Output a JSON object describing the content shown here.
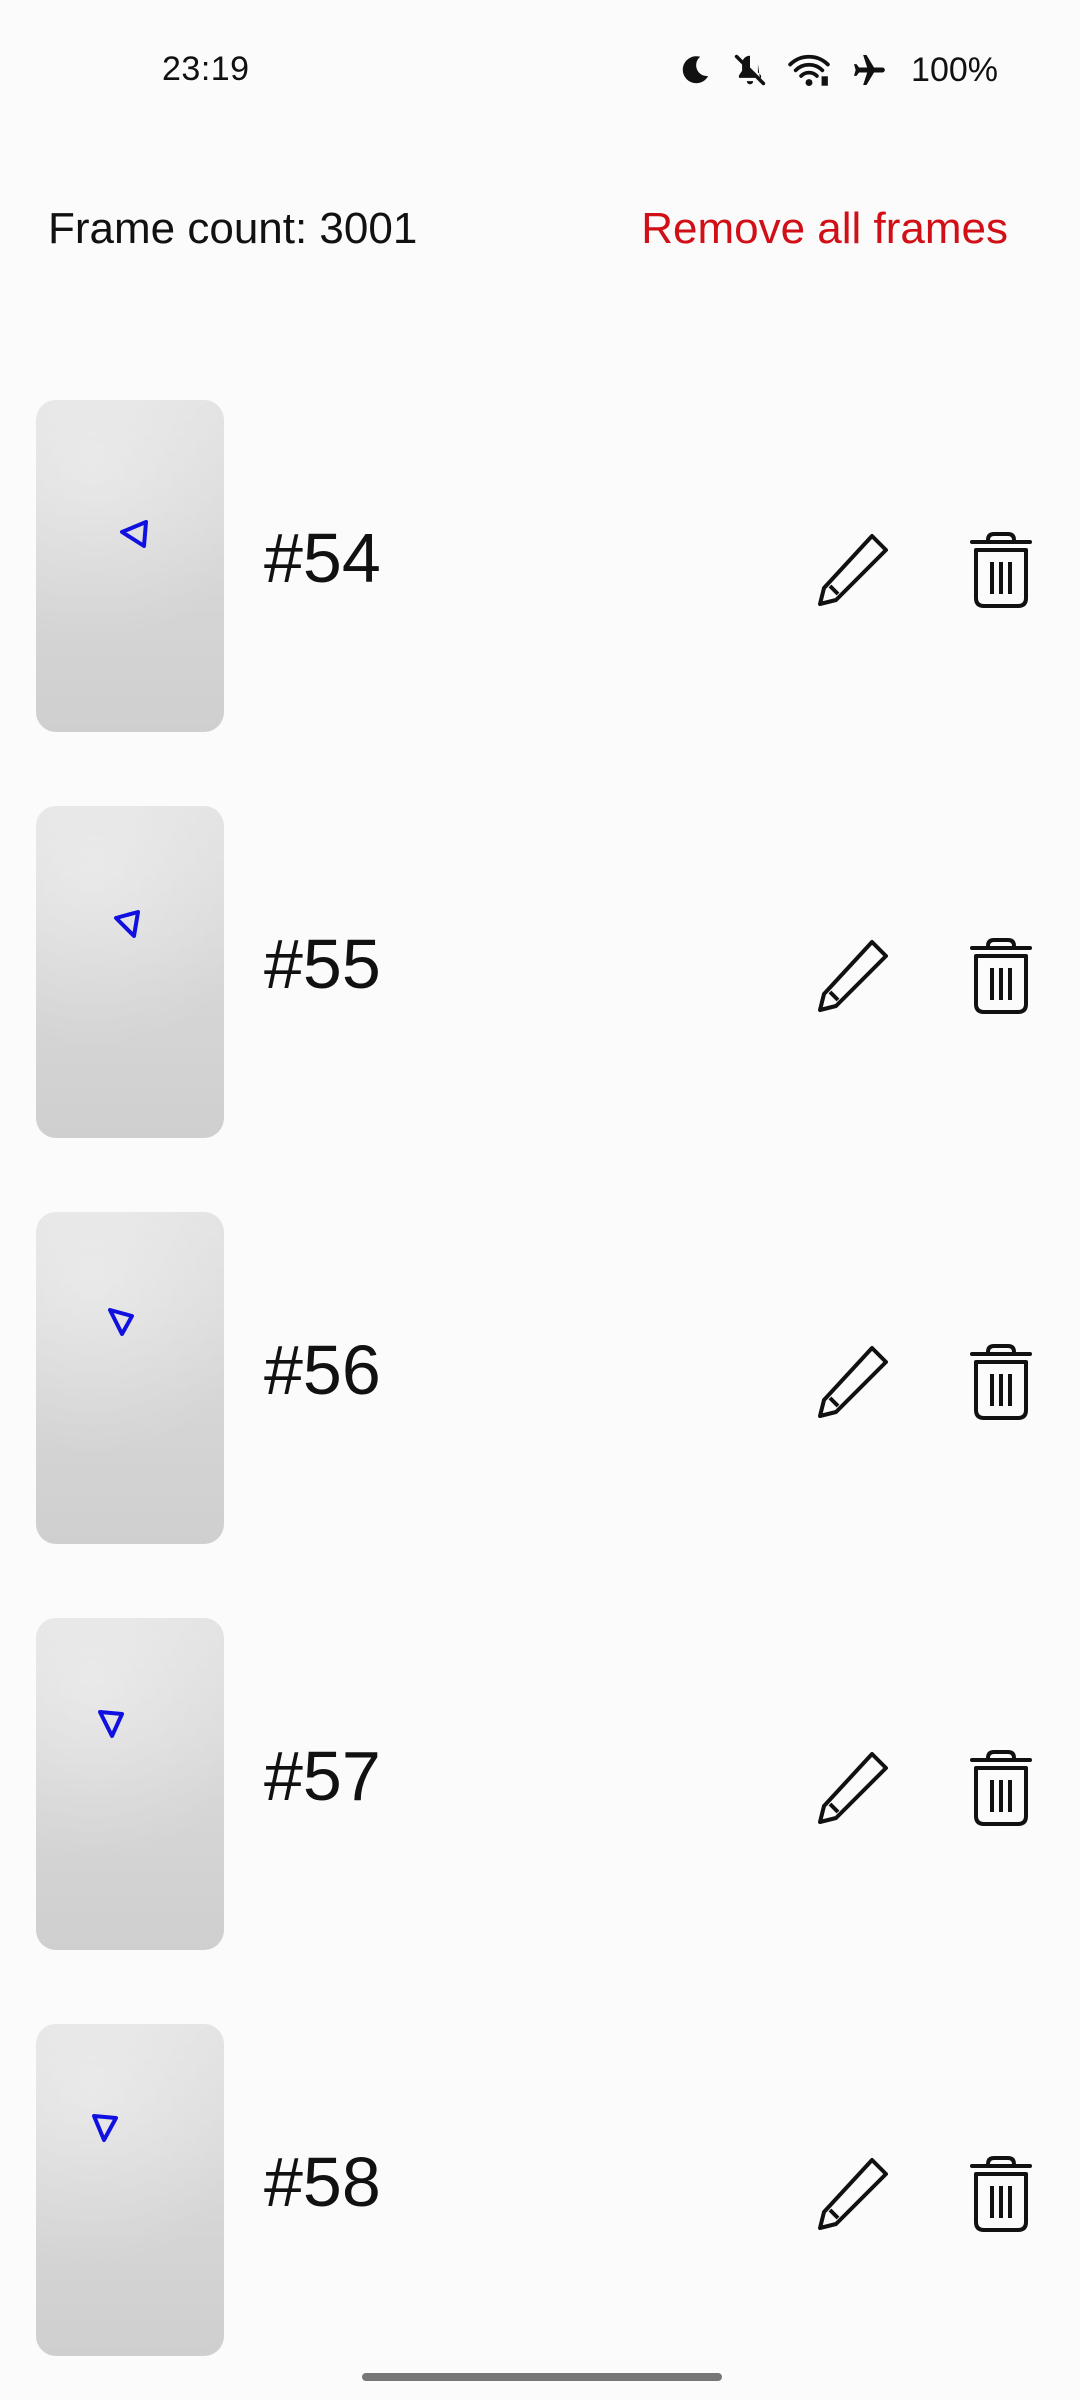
{
  "status_bar": {
    "time": "23:19",
    "icons": [
      "moon-icon",
      "bell-off-icon",
      "wifi-icon",
      "airplane-icon"
    ],
    "battery": "100%"
  },
  "header": {
    "frame_count": "Frame count: 3001",
    "remove_all_label": "Remove all frames",
    "remove_all_color": "#d10f16"
  },
  "frames": [
    {
      "label": "#54"
    },
    {
      "label": "#55"
    },
    {
      "label": "#56"
    },
    {
      "label": "#57"
    },
    {
      "label": "#58"
    }
  ],
  "frame_actions": {
    "edit_icon": "pencil-icon",
    "delete_icon": "trash-icon"
  },
  "colors": {
    "marker": "#1010e0",
    "background": "#fbfbfb",
    "text": "#111111"
  }
}
